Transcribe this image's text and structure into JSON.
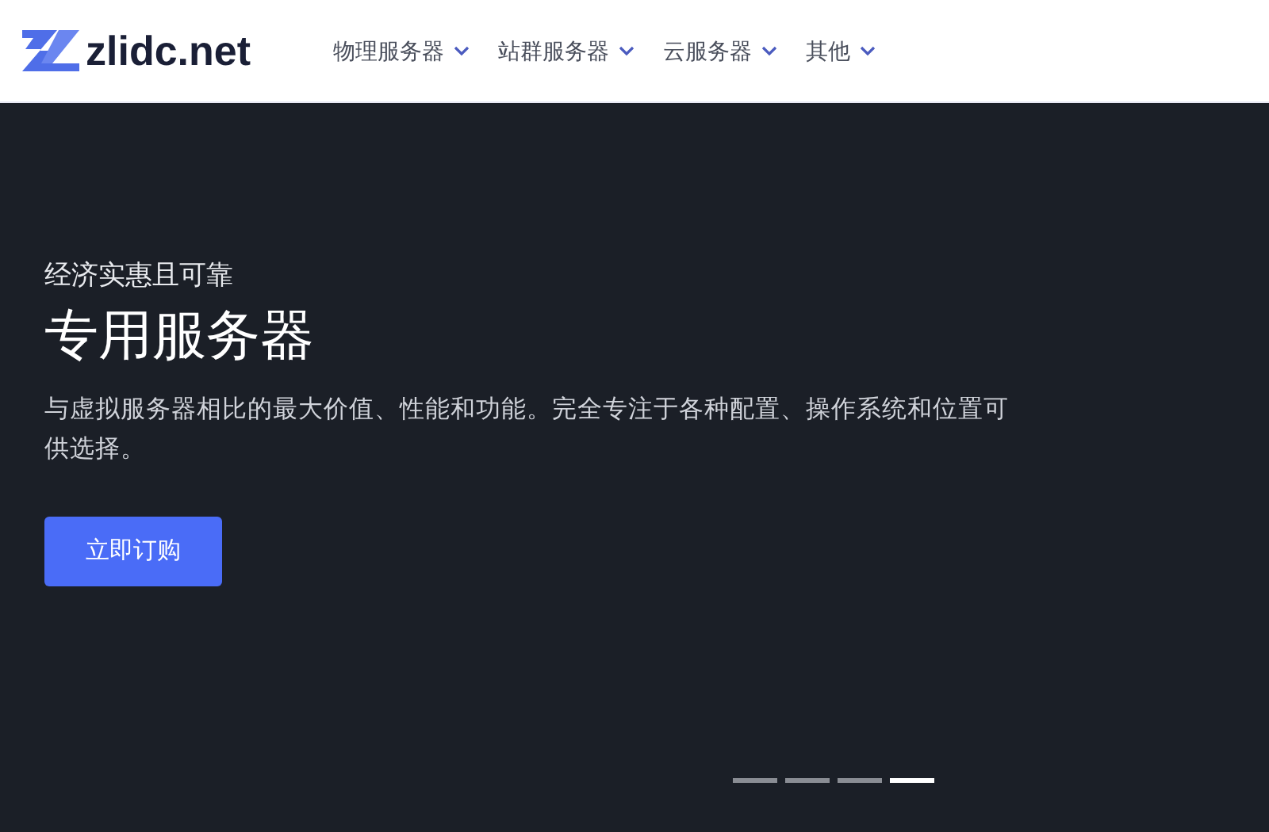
{
  "header": {
    "logo_text": "zlidc.net",
    "nav": [
      {
        "label": "物理服务器"
      },
      {
        "label": "站群服务器"
      },
      {
        "label": "云服务器"
      },
      {
        "label": "其他"
      }
    ]
  },
  "hero": {
    "eyebrow": "经济实惠且可靠",
    "title": "专用服务器",
    "description": "与虚拟服务器相比的最大价值、性能和功能。完全专注于各种配置、操作系统和位置可供选择。",
    "button": "立即订购",
    "slides": [
      {
        "selected": false
      },
      {
        "selected": false
      },
      {
        "selected": false
      },
      {
        "selected": true
      }
    ]
  }
}
